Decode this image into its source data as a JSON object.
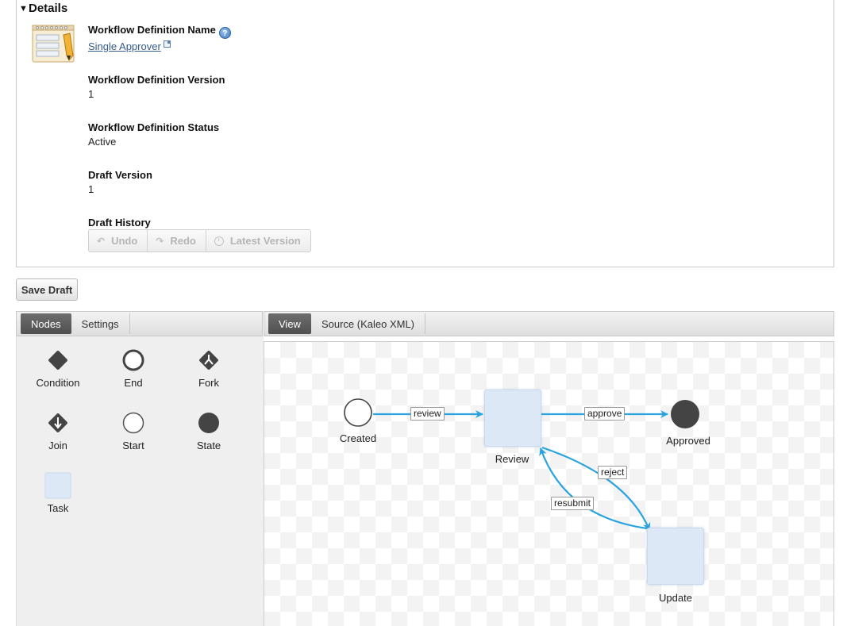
{
  "details": {
    "title": "Details",
    "workflow_name_label": "Workflow Definition Name",
    "workflow_name_value": "Single Approver",
    "workflow_version_label": "Workflow Definition Version",
    "workflow_version_value": "1",
    "workflow_status_label": "Workflow Definition Status",
    "workflow_status_value": "Active",
    "draft_version_label": "Draft Version",
    "draft_version_value": "1",
    "draft_history_label": "Draft History",
    "undo_label": "Undo",
    "redo_label": "Redo",
    "latest_label": "Latest Version"
  },
  "save_draft_label": "Save Draft",
  "left_tabs": [
    "Nodes",
    "Settings"
  ],
  "right_tabs": [
    "View",
    "Source (Kaleo XML)"
  ],
  "palette": [
    "Condition",
    "End",
    "Fork",
    "Join",
    "Start",
    "State",
    "Task"
  ],
  "diagram": {
    "nodes": [
      "Created",
      "Review",
      "Approved",
      "Update"
    ],
    "edges": [
      "review",
      "approve",
      "reject",
      "resubmit"
    ]
  },
  "colors": {
    "edge": "#2aa3e0",
    "task_fill": "#dce8f6",
    "tab_active": "#5a5a5a"
  }
}
